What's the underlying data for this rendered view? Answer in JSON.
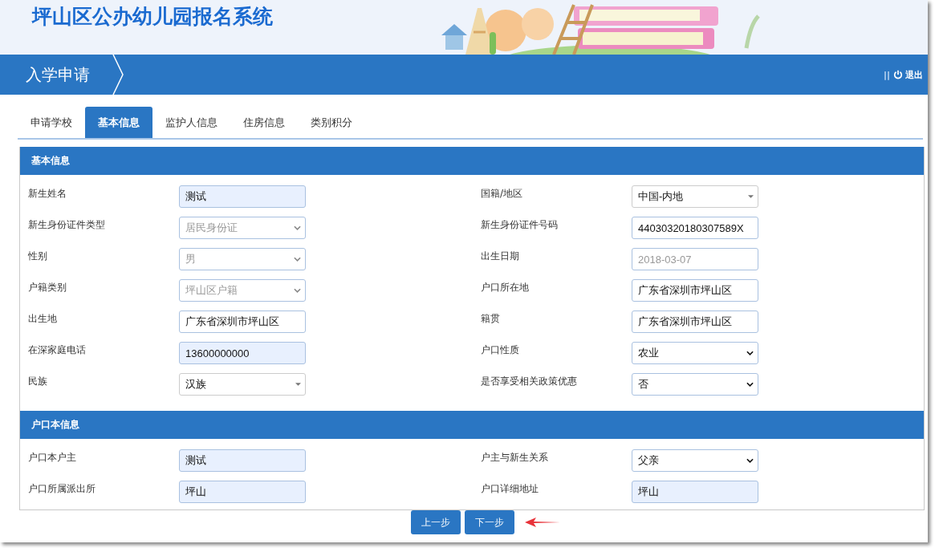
{
  "header": {
    "title": "坪山区公办幼儿园报名系统",
    "kind": "picture"
  },
  "nav": {
    "breadcrumb": "入学申请",
    "separator": "||",
    "logout": "退出"
  },
  "tabs": [
    {
      "label": "申请学校",
      "selected": false
    },
    {
      "label": "基本信息",
      "selected": true
    },
    {
      "label": "监护人信息",
      "selected": false
    },
    {
      "label": "住房信息",
      "selected": false
    },
    {
      "label": "类别积分",
      "selected": false
    }
  ],
  "sections": [
    {
      "title": "基本信息",
      "fields": [
        {
          "label": "新生姓名",
          "kind": "input",
          "value": "测试",
          "autofill": true,
          "disabled": false
        },
        {
          "label": "国籍/地区",
          "kind": "combo",
          "value": "中国-内地",
          "autofill": false,
          "disabled": false
        },
        {
          "label": "新生身份证件类型",
          "kind": "select",
          "value": "居民身份证",
          "autofill": false,
          "disabled": true
        },
        {
          "label": "新生身份证件号码",
          "kind": "input",
          "value": "44030320180307589X",
          "autofill": false,
          "disabled": false
        },
        {
          "label": "性别",
          "kind": "select",
          "value": "男",
          "autofill": false,
          "disabled": true
        },
        {
          "label": "出生日期",
          "kind": "input",
          "value": "2018-03-07",
          "autofill": false,
          "disabled": true
        },
        {
          "label": "户籍类别",
          "kind": "select",
          "value": "坪山区户籍",
          "autofill": false,
          "disabled": true
        },
        {
          "label": "户口所在地",
          "kind": "input",
          "value": "广东省深圳市坪山区",
          "autofill": false,
          "disabled": false
        },
        {
          "label": "出生地",
          "kind": "input",
          "value": "广东省深圳市坪山区",
          "autofill": false,
          "disabled": false
        },
        {
          "label": "籍贯",
          "kind": "input",
          "value": "广东省深圳市坪山区",
          "autofill": false,
          "disabled": false
        },
        {
          "label": "在深家庭电话",
          "kind": "input",
          "value": "13600000000",
          "autofill": true,
          "disabled": false
        },
        {
          "label": "户口性质",
          "kind": "select",
          "value": "农业",
          "autofill": false,
          "disabled": false
        },
        {
          "label": "民族",
          "kind": "combo",
          "value": "汉族",
          "autofill": false,
          "disabled": false
        },
        {
          "label": "是否享受相关政策优惠",
          "kind": "select",
          "value": "否",
          "autofill": false,
          "disabled": false
        }
      ]
    },
    {
      "title": "户口本信息",
      "fields": [
        {
          "label": "户口本户主",
          "kind": "input",
          "value": "测试",
          "autofill": true,
          "disabled": false
        },
        {
          "label": "户主与新生关系",
          "kind": "select",
          "value": "父亲",
          "autofill": false,
          "disabled": false
        },
        {
          "label": "户口所属派出所",
          "kind": "input",
          "value": "坪山",
          "autofill": true,
          "disabled": false
        },
        {
          "label": "户口详细地址",
          "kind": "input",
          "value": "坪山",
          "autofill": true,
          "disabled": false
        }
      ]
    }
  ],
  "buttons": [
    {
      "label": "上一步"
    },
    {
      "label": "下一步",
      "pointer": true
    }
  ]
}
